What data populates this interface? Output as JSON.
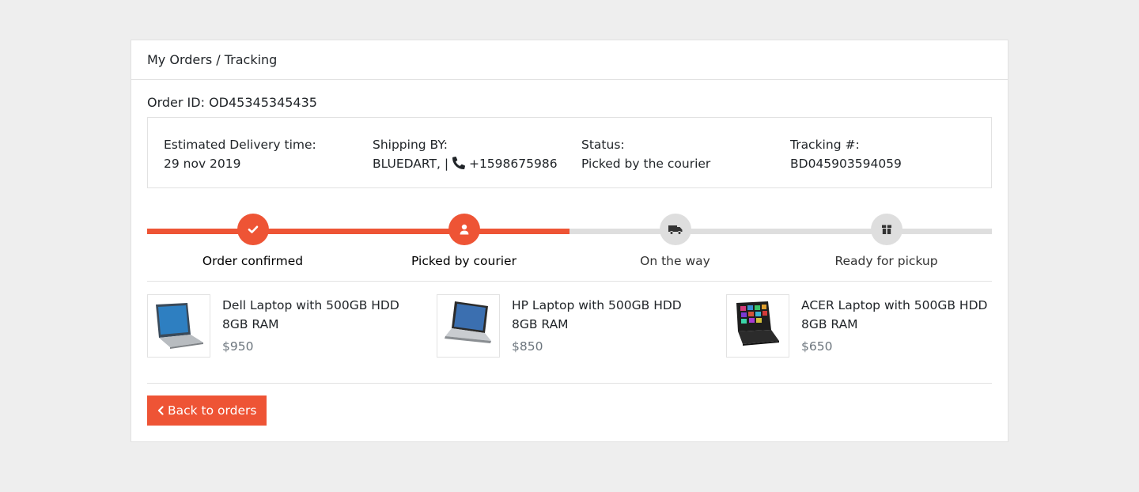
{
  "header": {
    "breadcrumb": "My Orders / Tracking"
  },
  "order": {
    "id_text": "Order ID: OD45345345435"
  },
  "info": [
    {
      "label": "Estimated Delivery time:",
      "value": "29 nov 2019"
    },
    {
      "label": "Shipping BY:",
      "value_prefix": "BLUEDART, | ",
      "icon": "phone-icon",
      "value_suffix": "+1598675986"
    },
    {
      "label": "Status:",
      "value": "Picked by the courier"
    },
    {
      "label": "Tracking #:",
      "value": "BD045903594059"
    }
  ],
  "tracking": {
    "progress_fraction": 0.5,
    "steps": [
      {
        "label": "Order confirmed",
        "icon": "check-icon",
        "state": "done"
      },
      {
        "label": "Picked by courier",
        "icon": "user-icon",
        "state": "done"
      },
      {
        "label": "On the way",
        "icon": "truck-icon",
        "state": "pending"
      },
      {
        "label": "Ready for pickup",
        "icon": "box-icon",
        "state": "pending"
      }
    ]
  },
  "products": [
    {
      "name_line1": "Dell Laptop with 500GB HDD",
      "name_line2": "8GB RAM",
      "price": "$950"
    },
    {
      "name_line1": "HP Laptop with 500GB HDD",
      "name_line2": "8GB RAM",
      "price": "$850"
    },
    {
      "name_line1": "ACER Laptop with 500GB HDD",
      "name_line2": "8GB RAM",
      "price": "$650"
    }
  ],
  "actions": {
    "back_label": "Back to orders"
  },
  "colors": {
    "accent": "#ee5435",
    "track_pending": "#dedede",
    "border": "#e2e2e2",
    "page_bg": "#eeeeee",
    "price": "#6c757d"
  }
}
